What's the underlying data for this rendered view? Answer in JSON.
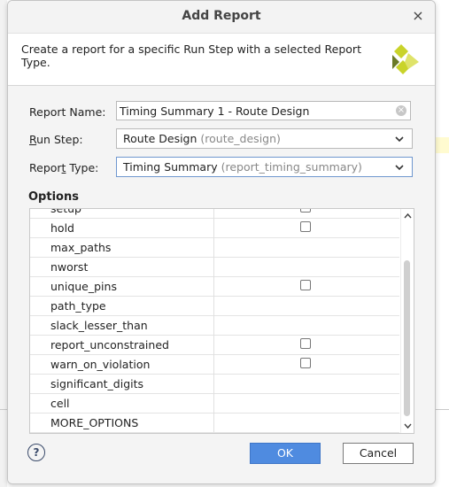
{
  "dialog": {
    "title": "Add Report",
    "close_glyph": "×",
    "description": "Create a report for a specific Run Step with a selected Report Type."
  },
  "form": {
    "report_name_label": "Report Name:",
    "report_name_value": "Timing Summary 1 - Route Design",
    "run_step_label_first": "R",
    "run_step_label_rest": "un Step:",
    "run_step_value": "Route Design",
    "run_step_hint": "(route_design)",
    "report_type_label_pre": "Repor",
    "report_type_label_ul": "t",
    "report_type_label_post": " Type:",
    "report_type_value": "Timing Summary",
    "report_type_hint": "(report_timing_summary)"
  },
  "options": {
    "title": "Options",
    "rows": [
      {
        "name": "setup",
        "checkbox": true
      },
      {
        "name": "hold",
        "checkbox": true
      },
      {
        "name": "max_paths",
        "checkbox": false
      },
      {
        "name": "nworst",
        "checkbox": false
      },
      {
        "name": "unique_pins",
        "checkbox": true
      },
      {
        "name": "path_type",
        "checkbox": false
      },
      {
        "name": "slack_lesser_than",
        "checkbox": false
      },
      {
        "name": "report_unconstrained",
        "checkbox": true
      },
      {
        "name": "warn_on_violation",
        "checkbox": true
      },
      {
        "name": "significant_digits",
        "checkbox": false
      },
      {
        "name": "cell",
        "checkbox": false
      },
      {
        "name": "MORE_OPTIONS",
        "checkbox": false
      }
    ]
  },
  "footer": {
    "help_label": "?",
    "ok_label": "OK",
    "cancel_label": "Cancel"
  },
  "icons": {
    "logo": "vivado-logo-icon",
    "clear": "clear-icon",
    "chevron": "chevron-down-icon"
  },
  "colors": {
    "accent": "#4f8be0",
    "logo": "#c9d32a"
  }
}
